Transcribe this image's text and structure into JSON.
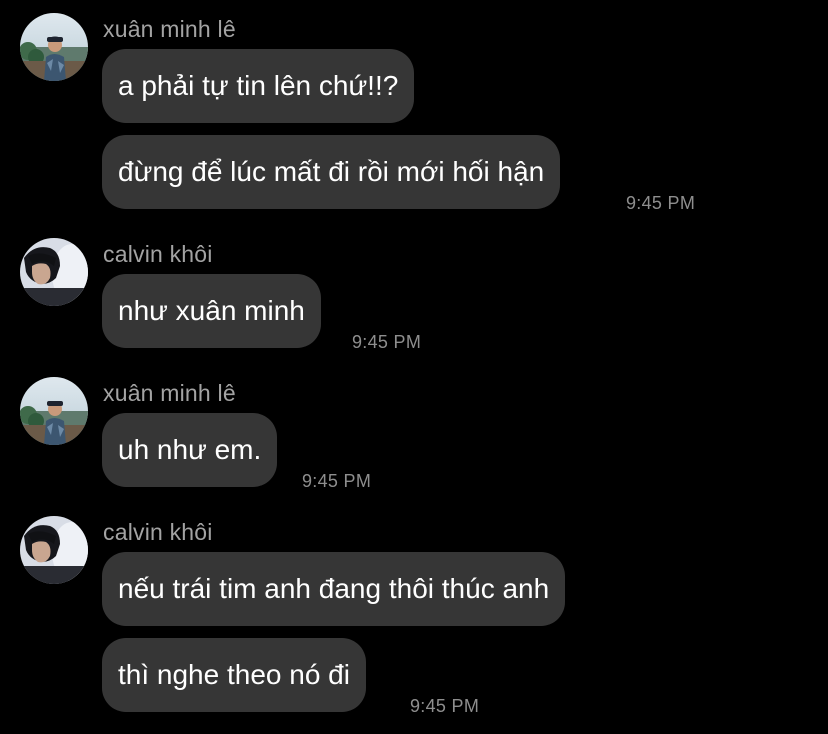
{
  "colors": {
    "background": "#000000",
    "bubble": "#363636",
    "sender_text": "#a3a3a3",
    "timestamp_text": "#8e8e8e",
    "message_text": "#ffffff"
  },
  "messages": [
    {
      "sender": "xuân minh lê",
      "avatar": "avatar-xuan-minh",
      "bubbles": [
        "a phải tự tin lên chứ!!?",
        "đừng để lúc mất đi rồi mới hối hận"
      ],
      "time": "9:45 PM"
    },
    {
      "sender": "calvin khôi",
      "avatar": "avatar-calvin-khoi",
      "bubbles": [
        "như xuân minh"
      ],
      "time": "9:45 PM"
    },
    {
      "sender": "xuân minh lê",
      "avatar": "avatar-xuan-minh",
      "bubbles": [
        "uh như em."
      ],
      "time": "9:45 PM"
    },
    {
      "sender": "calvin khôi",
      "avatar": "avatar-calvin-khoi",
      "bubbles": [
        "nếu trái tim anh đang thôi thúc anh",
        "thì nghe theo nó đi"
      ],
      "time": "9:45 PM"
    }
  ]
}
